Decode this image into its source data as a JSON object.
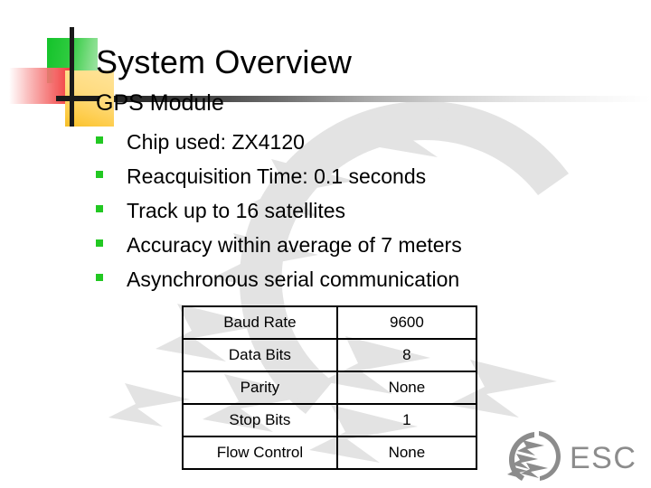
{
  "slide": {
    "title": "System Overview",
    "subtitle": "GPS Module",
    "bullets": [
      {
        "text": "Chip used: ZX4120"
      },
      {
        "text": "Reacquisition Time: 0.1 seconds"
      },
      {
        "text": "Track up to 16 satellites"
      },
      {
        "text": "Accuracy within average of 7 meters"
      },
      {
        "text": "Asynchronous serial communication"
      }
    ],
    "table": {
      "rows": [
        {
          "name": "Baud Rate",
          "value": "9600"
        },
        {
          "name": "Data Bits",
          "value": "8"
        },
        {
          "name": "Parity",
          "value": "None"
        },
        {
          "name": "Stop Bits",
          "value": "1"
        },
        {
          "name": "Flow Control",
          "value": "None"
        }
      ]
    },
    "brand": {
      "name": "ESC"
    },
    "colors": {
      "bullet_green": "#22c822",
      "deco_green": "#2ecb3f",
      "deco_red": "#f46b6b",
      "deco_yellow": "#fdc93f",
      "rule_dark": "#1c1c1c",
      "text": "#000000",
      "watermark_gray": "#e2e2e2",
      "brand_gray": "#8c8c8c"
    }
  }
}
